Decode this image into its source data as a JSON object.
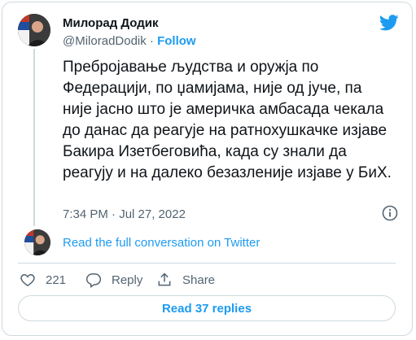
{
  "author": {
    "name": "Милорад Додик",
    "handle": "@MiloradDodik",
    "separator": " · ",
    "follow_label": "Follow"
  },
  "tweet": {
    "text": "Пребројавање људства и оружја по Федерацији, по џамијама, није од јуче, па није јасно што је америчка амбасада чекала до данас да реагује на ратнохушкачке изјаве Бакира Изетбеговића, када су знали да реагују и на далеко безазленије изјаве у БиХ.",
    "timestamp": "7:34 PM · Jul 27, 2022"
  },
  "conversation_link": "Read the full conversation on Twitter",
  "actions": {
    "like_count": "221",
    "reply_label": "Reply",
    "share_label": "Share"
  },
  "replies_button": "Read 37 replies",
  "colors": {
    "accent": "#1d9bf0",
    "text": "#0f1419",
    "secondary": "#536471",
    "border": "#cfd9de"
  },
  "icons": {
    "brand": "twitter-bird-icon",
    "info": "info-icon",
    "like": "heart-icon",
    "reply": "reply-bubble-icon",
    "share": "share-upload-icon"
  }
}
